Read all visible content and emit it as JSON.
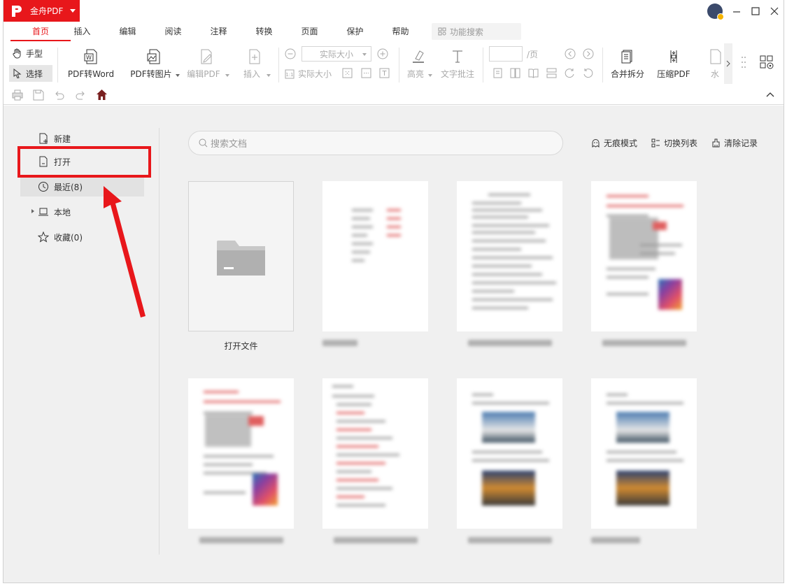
{
  "app": {
    "name": "金舟PDF"
  },
  "menu": {
    "tabs": [
      "首页",
      "插入",
      "编辑",
      "阅读",
      "注释",
      "转换",
      "页面",
      "保护",
      "帮助"
    ],
    "search_placeholder": "功能搜索"
  },
  "ribbon": {
    "hand": "手型",
    "select": "选择",
    "pdf_to_word": "PDF转Word",
    "pdf_to_image": "PDF转图片",
    "edit_pdf": "编辑PDF",
    "insert": "插入",
    "zoom_value": "实际大小",
    "zoom_actual": "实际大小",
    "highlight": "高亮",
    "text_comment": "文字批注",
    "page_unit": "/页",
    "merge_split": "合并拆分",
    "compress_pdf": "压缩PDF",
    "watermark_partial": "水"
  },
  "sidebar": {
    "items": [
      {
        "label": "新建"
      },
      {
        "label": "打开"
      },
      {
        "label": "最近(8)"
      },
      {
        "label": "本地"
      },
      {
        "label": "收藏(0)"
      }
    ]
  },
  "main": {
    "search_placeholder": "搜索文档",
    "actions": [
      "无痕模式",
      "切换列表",
      "清除记录"
    ],
    "open_file_label": "打开文件"
  },
  "colors": {
    "brand": "#e8171b",
    "annotation": "#e8171b"
  }
}
